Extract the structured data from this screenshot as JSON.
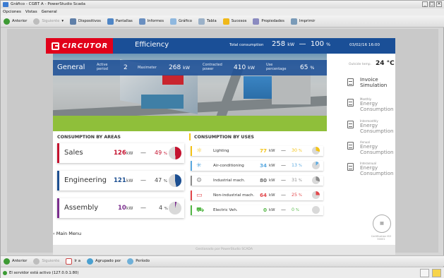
{
  "window": {
    "title": "Gráfico - CGBT A - PowerStudio Scada",
    "controls": [
      "_",
      "□",
      "✕"
    ]
  },
  "menu": [
    "Opciones",
    "Vistas",
    "General"
  ],
  "toolbar": {
    "back": "Anterior",
    "next": "Siguiente",
    "devices": "Dispositivos",
    "screens": "Pantallas",
    "reports": "Informes",
    "chart": "Gráfico",
    "table": "Tabla",
    "events": "Sucesos",
    "properties": "Propiedades",
    "print": "Imprimir"
  },
  "header": {
    "brand": "CIRCUTOR",
    "title": "Efficiency",
    "total_consumption_label": "Total consumption",
    "total_consumption_value": "258",
    "total_consumption_unit": "kW",
    "dash": "—",
    "total_pct": "100",
    "pct_unit": "%",
    "datetime": "03/02/16 16:00"
  },
  "general": {
    "title": "General",
    "active_period_label": "Active period",
    "active_period_value": "2",
    "maximeter_label": "Maximeter",
    "maximeter_value": "268",
    "maximeter_unit": "kW",
    "contracted_label": "Contracted power",
    "contracted_value": "410",
    "contracted_unit": "kW",
    "use_pct_label": "Use percentage",
    "use_pct_value": "65",
    "use_pct_unit": "%"
  },
  "right_panel": {
    "outside_label": "Outside temp.",
    "outside_value": "24 °C",
    "items": [
      {
        "small": "",
        "label": "Invoice Simulation"
      },
      {
        "small": "Monthly",
        "label": "Energy Consumption"
      },
      {
        "small": "Intermonthly",
        "label": "Energy Consumption"
      },
      {
        "small": "Annual",
        "label": "Energy Consumption"
      },
      {
        "small": "Interannual",
        "label": "Energy Consumption"
      }
    ],
    "seal_text": "Certification ISO 50001"
  },
  "areas": {
    "heading": "CONSUMPTION BY AREAS",
    "rows": [
      {
        "name": "Sales",
        "value": "126",
        "unit": "kW",
        "pct": "49",
        "color": "#c4122f",
        "fraction": 0.49
      },
      {
        "name": "Engineering",
        "value": "121",
        "unit": "kW",
        "pct": "47",
        "color": "#1d4f91",
        "fraction": 0.47
      },
      {
        "name": "Assembly",
        "value": "10",
        "unit": "kW",
        "pct": "4",
        "color": "#7b2e8e",
        "fraction": 0.04
      }
    ]
  },
  "uses": {
    "heading": "CONSUMPTION BY USES",
    "rows": [
      {
        "name": "Lighting",
        "value": "77",
        "unit": "kW",
        "pct": "30",
        "color": "#f3c315",
        "icon": "sun-icon",
        "glyph": "☼",
        "fraction": 0.3
      },
      {
        "name": "Air-conditioning",
        "value": "34",
        "unit": "kW",
        "pct": "13",
        "color": "#5aa9e0",
        "icon": "snowflake-icon",
        "glyph": "✳",
        "fraction": 0.13
      },
      {
        "name": "Industrial mach.",
        "value": "80",
        "unit": "kW",
        "pct": "31",
        "color": "#8c8c8c",
        "icon": "gear-icon",
        "glyph": "⚙",
        "fraction": 0.31
      },
      {
        "name": "Non-industrial mach.",
        "value": "64",
        "unit": "kW",
        "pct": "25",
        "color": "#e2474b",
        "icon": "monitor-icon",
        "glyph": "▭",
        "fraction": 0.25
      },
      {
        "name": "Electric Veh.",
        "value": "0",
        "unit": "kW",
        "pct": "0",
        "color": "#55b747",
        "icon": "car-icon",
        "glyph": "⛟",
        "fraction": 0.0
      }
    ]
  },
  "main_menu": "Main Menu",
  "footer_note": "Gestionado por PowerStudio SCADA",
  "bottom_toolbar": {
    "back": "Anterior",
    "next": "Siguiente",
    "goto": "Ir a",
    "group": "Agrupado por",
    "period": "Período"
  },
  "status": {
    "text": "El servidor está activo (127.0.0.1:80)"
  }
}
